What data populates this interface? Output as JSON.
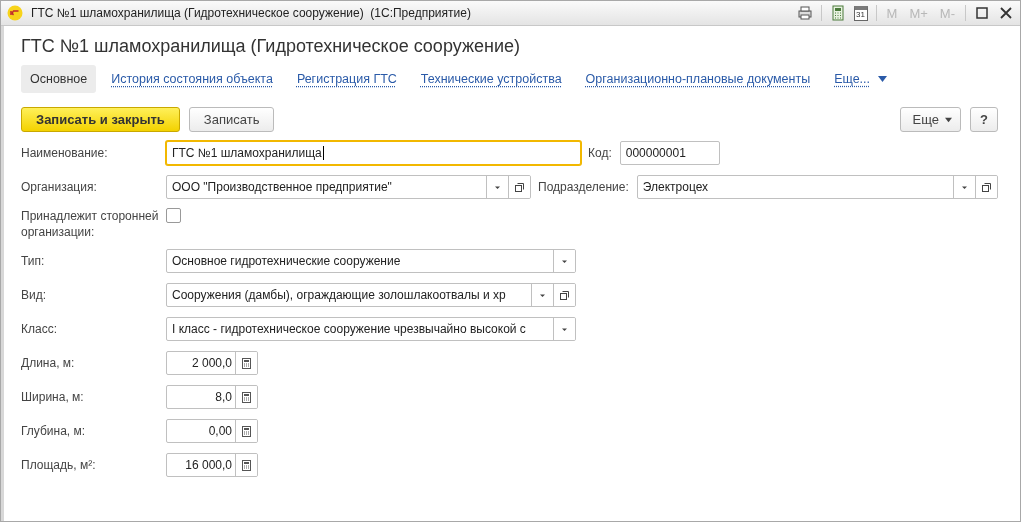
{
  "window": {
    "title": "ГТС №1 шламохранилища (Гидротехническое сооружение)  (1С:Предприятие)",
    "calendar_day": "31",
    "memory_buttons": [
      {
        "label": "M",
        "disabled": true
      },
      {
        "label": "M+",
        "disabled": true
      },
      {
        "label": "M-",
        "disabled": true
      }
    ]
  },
  "form_title": "ГТС №1 шламохранилища (Гидротехническое сооружение)",
  "tabs": [
    {
      "label": "Основное",
      "selected": true
    },
    {
      "label": "История состояния объекта",
      "selected": false
    },
    {
      "label": "Регистрация ГТС",
      "selected": false
    },
    {
      "label": "Технические устройства",
      "selected": false
    },
    {
      "label": "Организационно-плановые документы",
      "selected": false
    }
  ],
  "tabs_more": "Еще...",
  "command_bar": {
    "primary": "Записать и закрыть",
    "secondary": "Записать",
    "more": "Еще",
    "help": "?"
  },
  "rows": [
    {
      "label": "Наименование:",
      "field": {
        "kind": "text",
        "value": "ГТС №1 шламохранилища",
        "focused": true
      },
      "extra": {
        "label": "Код:",
        "field": {
          "kind": "text",
          "value": "000000001",
          "focused": false
        }
      }
    },
    {
      "label": "Организация:",
      "field": {
        "kind": "select",
        "value": "ООО \"Производственное предприятие\"",
        "open_button": true
      },
      "extra": {
        "label": "Подразделение:",
        "field": {
          "kind": "select",
          "value": "Электроцех",
          "open_button": true
        }
      }
    },
    {
      "label": "Принадлежит сторонней организации:",
      "field": {
        "kind": "checkbox",
        "checked": false
      }
    },
    {
      "label": "Тип:",
      "field": {
        "kind": "select",
        "value": "Основное гидротехнические сооружение",
        "open_button": false
      }
    },
    {
      "label": "Вид:",
      "field": {
        "kind": "select",
        "value": "Сооружения (дамбы), ограждающие золошлакоотвалы и хр",
        "open_button": true
      }
    },
    {
      "label": "Класс:",
      "field": {
        "kind": "select",
        "value": "I класс - гидротехническое сооружение чрезвычайно высокой с",
        "open_button": false
      }
    },
    {
      "label": "Длина, м:",
      "field": {
        "kind": "number",
        "value": "2 000,0"
      }
    },
    {
      "label": "Ширина, м:",
      "field": {
        "kind": "number",
        "value": "8,0"
      }
    },
    {
      "label": "Глубина, м:",
      "field": {
        "kind": "number",
        "value": "0,00"
      }
    },
    {
      "label": "Площадь, м²:",
      "field": {
        "kind": "number",
        "value": "16 000,0"
      }
    }
  ]
}
